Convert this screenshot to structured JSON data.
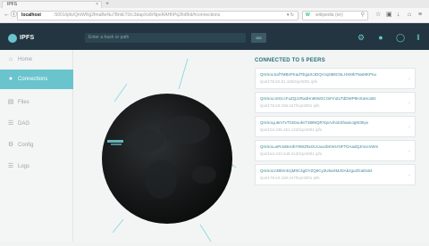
{
  "browser": {
    "tab_title": "IPFS",
    "tab_close": "×",
    "new_tab": "+",
    "url_host": "localhost",
    "url_path": ":5001/ipfs/QmWRg2fmaBeNu7BmETtXc3dapXo8rNpeRAHhPq2fo8hd/#connections",
    "search_placeholder": "wikipedia (en)",
    "search_engine_glyph": "W"
  },
  "app": {
    "name": "IPFS",
    "hash_placeholder": "Enter a hash or path",
    "hash_button": "GO"
  },
  "sidebar": {
    "items": [
      {
        "label": "Home",
        "icon": "home-icon",
        "glyph": "⌂",
        "active": false
      },
      {
        "label": "Connections",
        "icon": "connections-icon",
        "glyph": "●",
        "active": true
      },
      {
        "label": "Files",
        "icon": "files-icon",
        "glyph": "▤",
        "active": false
      },
      {
        "label": "DAG",
        "icon": "dag-icon",
        "glyph": "☰",
        "active": false
      },
      {
        "label": "Config",
        "icon": "config-icon",
        "glyph": "⚙",
        "active": false
      },
      {
        "label": "Logs",
        "icon": "logs-icon",
        "glyph": "☰",
        "active": false
      }
    ]
  },
  "peers": {
    "title": "CONNECTED TO 5 PEERS",
    "list": [
      {
        "id": "QmSoLSafTMBsPKadTEgaXctDQVcqN88CNLHXMkTNwMKPnu",
        "addr": "/ip4/178.62.61.185/tcp/4001 ipfs"
      },
      {
        "id": "QmSoLnSGccFuZQJzRadHn95W2CrSFmZuTdDWP8HXaHca9z",
        "addr": "/ip4/178.62.158.247/tcp/4001 ipfs"
      },
      {
        "id": "QmSoLju6m7xTh3DuokvT3886QRYqxAzb1kShaanJgW36yx",
        "addr": "/ip4/104.236.151.122/tcp/4001 ipfs"
      },
      {
        "id": "QmSoLueR4xBeUbY9WZ9xGUUxunbKWcrNFTDAadQJmocnWm",
        "addr": "/ip4/162.243.248.213/tcp/4001 ipfs"
      },
      {
        "id": "QmSoLV4Bbm51jM9C4gDYZQ9Cy3U6aXMJDAbzgu2fzaDs64",
        "addr": "/ip4/178.62.158.247/tcp/4001 ipfs"
      }
    ]
  },
  "colors": {
    "accent": "#69c4cd",
    "header": "#223540",
    "globe": "#151718"
  }
}
